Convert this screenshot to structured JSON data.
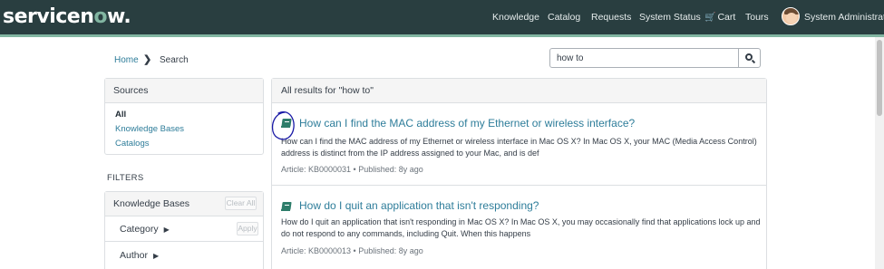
{
  "header": {
    "logo_pre": "servicen",
    "logo_o": "o",
    "logo_post": "w.",
    "nav": [
      "Knowledge",
      "Catalog",
      "Requests",
      "System Status",
      "Cart",
      "Tours"
    ],
    "user_name": "System Administrator"
  },
  "breadcrumb": {
    "home": "Home",
    "current": "Search"
  },
  "search": {
    "value": "how to"
  },
  "sources": {
    "title": "Sources",
    "items": [
      "All",
      "Knowledge Bases",
      "Catalogs"
    ]
  },
  "filters": {
    "title": "FILTERS",
    "kb_title": "Knowledge Bases",
    "clear_label": "Clear All",
    "facets": [
      "Category",
      "Author"
    ],
    "apply_label": "Apply"
  },
  "results": {
    "header": "All results for \"how to\"",
    "items": [
      {
        "title": "How can I find the MAC address of my Ethernet or wireless interface?",
        "snippet": "How can I find the MAC address of my Ethernet or wireless interface in Mac OS X? In Mac OS X, your MAC (Media Access Control) address is distinct from the IP address assigned to your Mac, and is def",
        "meta": "Article: KB0000031 • Published: 8y ago"
      },
      {
        "title": "How do I quit an application that isn't responding?",
        "snippet": "How do I quit an application that isn't responding in Mac OS X? In Mac OS X, you may occasionally find that applications lock up and do not respond to any commands, including Quit. When this happens",
        "meta": "Article: KB0000013 • Published: 8y ago"
      }
    ]
  },
  "colors": {
    "header_bg": "#293e40",
    "accent": "#81b5a1",
    "link": "#2e7d9a",
    "annotation": "#1a1aa6"
  }
}
